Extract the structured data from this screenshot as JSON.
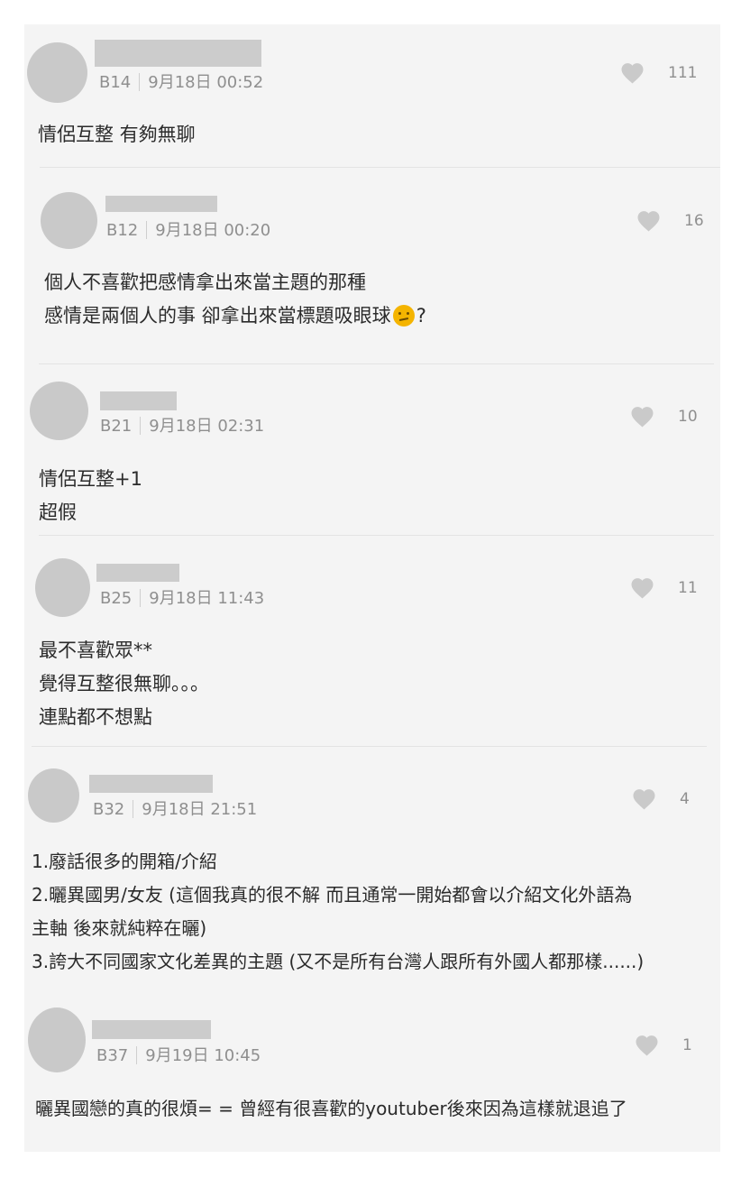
{
  "comments": [
    {
      "floor": "B14",
      "time": "9月18日 00:52",
      "likes": "111",
      "lines": [
        "情侶互整 有夠無聊"
      ]
    },
    {
      "floor": "B12",
      "time": "9月18日 00:20",
      "likes": "16",
      "lines": [
        "個人不喜歡把感情拿出來當主題的那種",
        "感情是兩個人的事 卻拿出來當標題吸眼球",
        "?"
      ],
      "emoji": "thinking-face"
    },
    {
      "floor": "B21",
      "time": "9月18日 02:31",
      "likes": "10",
      "lines": [
        "情侶互整+1",
        "超假"
      ]
    },
    {
      "floor": "B25",
      "time": "9月18日 11:43",
      "likes": "11",
      "lines": [
        "最不喜歡眾**",
        "覺得互整很無聊。。。",
        "連點都不想點"
      ]
    },
    {
      "floor": "B32",
      "time": "9月18日 21:51",
      "likes": "4",
      "lines": [
        "1.廢話很多的開箱/介紹",
        "2.曬異國男/女友 (這個我真的很不解 而且通常一開始都會以介紹文化外語為",
        "主軸 後來就純粹在曬)",
        "3.誇大不同國家文化差異的主題 (又不是所有台灣人跟所有外國人都那樣......)"
      ]
    },
    {
      "floor": "B37",
      "time": "9月19日 10:45",
      "likes": "1",
      "lines": [
        "曬異國戀的真的很煩= = 曾經有很喜歡的youtuber後來因為這樣就退追了"
      ]
    }
  ],
  "icons": {
    "like": "heart-icon",
    "avatar": "avatar-placeholder"
  },
  "colors": {
    "panel": "#f4f4f4",
    "placeholder": "#c9c9c9",
    "meta_text": "#8f8f8f",
    "body_text": "#2b2b2b"
  }
}
